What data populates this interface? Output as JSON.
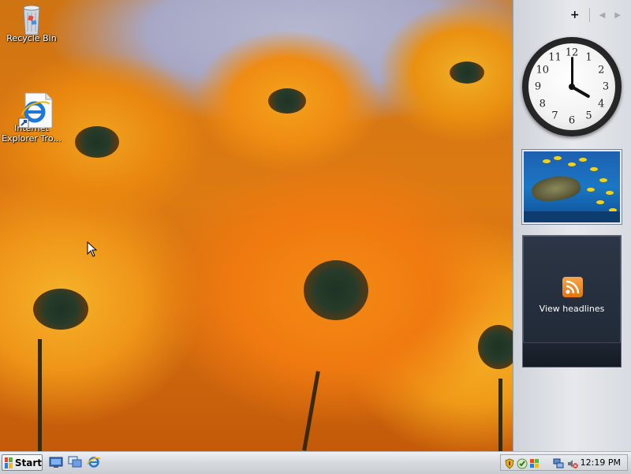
{
  "desktop": {
    "icons": [
      {
        "label": "Recycle Bin",
        "icon": "recycle-bin-icon"
      },
      {
        "label": "Internet\nExplorer Tro...",
        "icon": "internet-explorer-icon"
      }
    ]
  },
  "sidebar": {
    "controls": {
      "add_label": "+",
      "prev_label": "◀",
      "next_label": "▶"
    },
    "clock": {
      "hour": 4,
      "minute": 0,
      "numbers": [
        "12",
        "1",
        "2",
        "3",
        "4",
        "5",
        "6",
        "7",
        "8",
        "9",
        "10",
        "11"
      ]
    },
    "slideshow": {
      "subject": "sea turtle with yellow fish"
    },
    "feed": {
      "label": "View headlines",
      "icon": "rss-feed-icon",
      "accent": "#e8801a"
    }
  },
  "taskbar": {
    "start_label": "Start",
    "quick_launch": [
      "show-desktop-icon",
      "switch-windows-icon",
      "internet-explorer-icon"
    ],
    "tray_icons": [
      "security-shield-icon",
      "windows-defender-icon",
      "network-icon",
      "speaker-muted-icon"
    ],
    "clock": "12:19 PM"
  },
  "colors": {
    "taskbar": "#d6dade",
    "sidebar": "#e0e3e8",
    "headline_panel": "#1f2734"
  }
}
